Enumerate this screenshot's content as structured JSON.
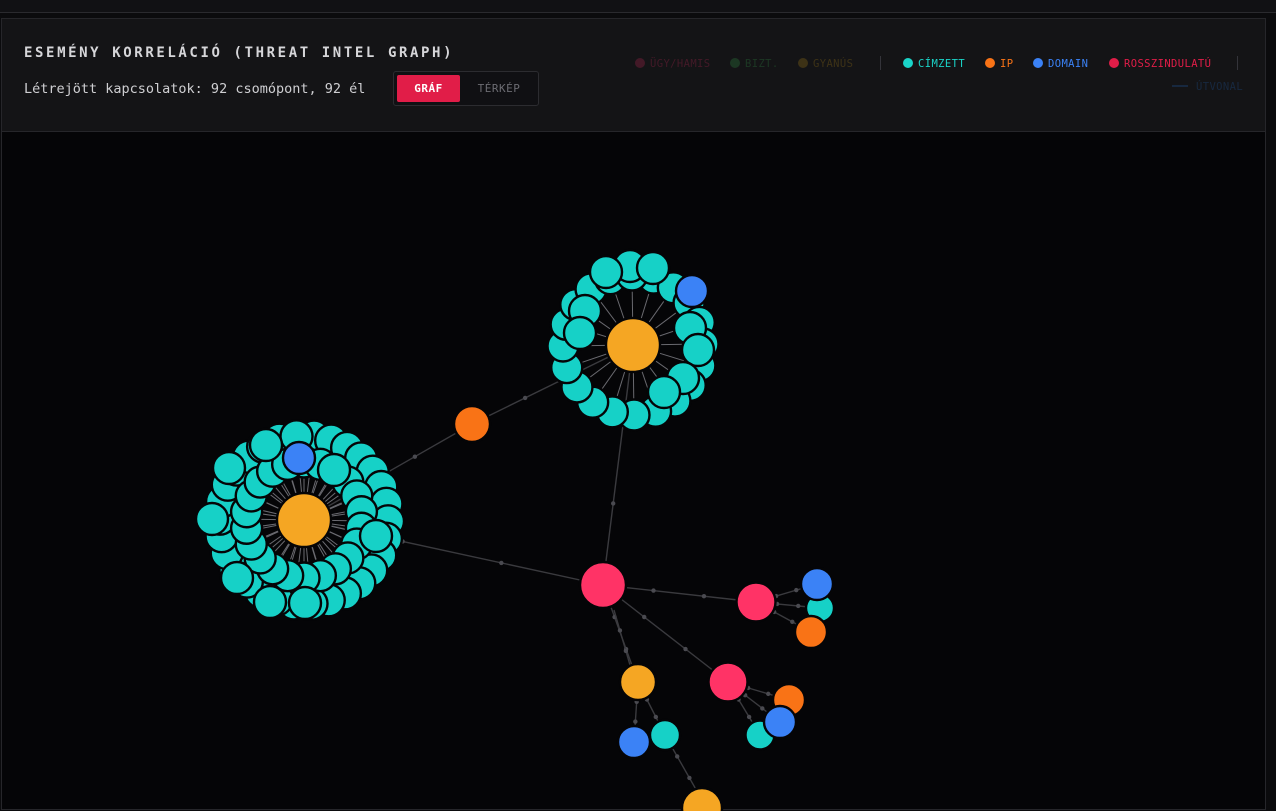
{
  "header": {
    "title": "ESEMÉNY KORRELÁCIÓ (THREAT INTEL GRAPH)",
    "subtitle": "Létrejött kapcsolatok: 92 csomópont, 92 él"
  },
  "view_toggle": {
    "graph_label": "GRÁF",
    "map_label": "TÉRKÉP",
    "active": "graph"
  },
  "legend": {
    "status": [
      {
        "label": "ÜGY/HAMIS",
        "color": "#9b2348"
      },
      {
        "label": "BIZT.",
        "color": "#2c7a3d"
      },
      {
        "label": "GYANÚS",
        "color": "#8a6a16"
      }
    ],
    "types": [
      {
        "label": "CÍMZETT",
        "color": "#1ad4c8"
      },
      {
        "label": "IP",
        "color": "#f97316"
      },
      {
        "label": "DOMAIN",
        "color": "#3b82f6"
      },
      {
        "label": "ROSSZINDULATÚ",
        "color": "#e11d48"
      }
    ],
    "path_label": "ÚTVONAL",
    "path_color": "#1e4e8c"
  },
  "graph_colors": {
    "recipient": "#16d1c7",
    "ip": "#f97316",
    "domain": "#3b82f6",
    "malicious": "#ff3366",
    "hub": "#f5a623",
    "edge": "#3a3a3e"
  }
}
